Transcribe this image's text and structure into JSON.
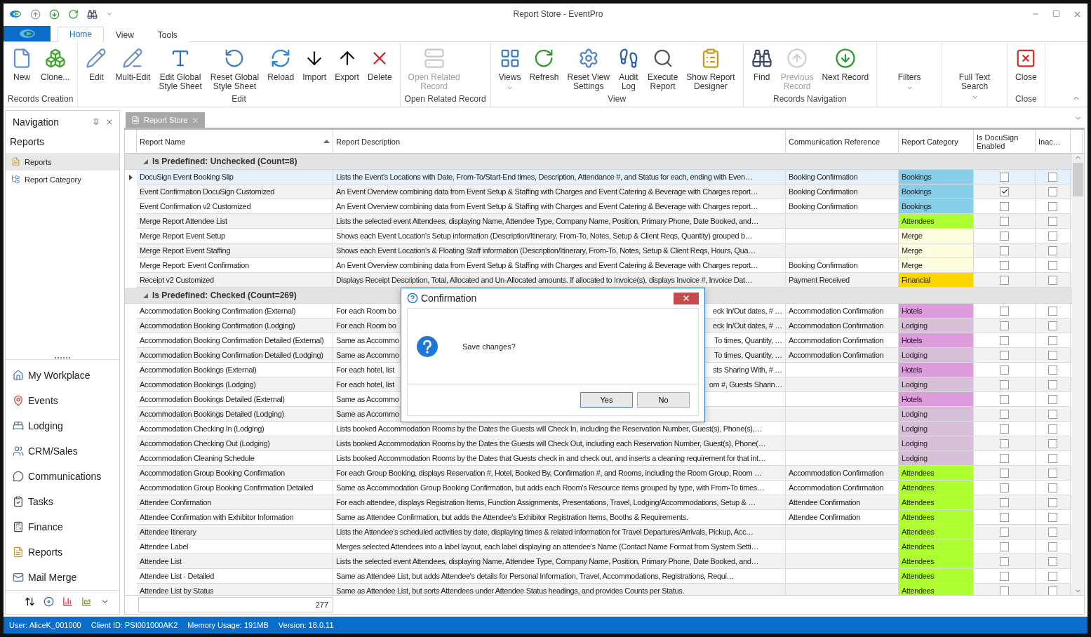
{
  "window": {
    "title": "Report Store - EventPro"
  },
  "tabs": [
    {
      "label": "Home",
      "selected": true
    },
    {
      "label": "View",
      "selected": false
    },
    {
      "label": "Tools",
      "selected": false
    }
  ],
  "ribbon": {
    "groups": [
      {
        "label": "Records Creation",
        "buttons": [
          {
            "label": "New",
            "kind": "new",
            "disabled": false,
            "dropdown": false
          },
          {
            "label": "Clone...",
            "kind": "clone",
            "disabled": false,
            "dropdown": false
          }
        ]
      },
      {
        "label": "Edit",
        "buttons": [
          {
            "label": "Edit",
            "kind": "edit",
            "disabled": false,
            "dropdown": false
          },
          {
            "label": "Multi-Edit",
            "kind": "multiedit",
            "disabled": false,
            "dropdown": false
          },
          {
            "label": "Edit Global\nStyle Sheet",
            "kind": "style",
            "disabled": false,
            "dropdown": false
          },
          {
            "label": "Reset Global\nStyle Sheet",
            "kind": "reset",
            "disabled": false,
            "dropdown": false
          },
          {
            "label": "Reload",
            "kind": "reload",
            "disabled": false,
            "dropdown": false
          },
          {
            "label": "Import",
            "kind": "import",
            "disabled": false,
            "dropdown": false
          },
          {
            "label": "Export",
            "kind": "export",
            "disabled": false,
            "dropdown": false
          },
          {
            "label": "Delete",
            "kind": "delete",
            "disabled": false,
            "dropdown": false
          }
        ]
      },
      {
        "label": "Open Related Record",
        "buttons": [
          {
            "label": "Open Related\nRecord",
            "kind": "related",
            "disabled": true,
            "dropdown": false
          }
        ]
      },
      {
        "label": "View",
        "buttons": [
          {
            "label": "Views",
            "kind": "views",
            "disabled": false,
            "dropdown": true
          },
          {
            "label": "Refresh",
            "kind": "refresh",
            "disabled": false,
            "dropdown": false
          },
          {
            "label": "Reset View\nSettings",
            "kind": "resetview",
            "disabled": false,
            "dropdown": false
          },
          {
            "label": "Audit\nLog",
            "kind": "audit",
            "disabled": false,
            "dropdown": false
          },
          {
            "label": "Execute\nReport",
            "kind": "execute",
            "disabled": false,
            "dropdown": false
          },
          {
            "label": "Show Report\nDesigner",
            "kind": "designer",
            "disabled": false,
            "dropdown": false
          }
        ]
      },
      {
        "label": "Records Navigation",
        "buttons": [
          {
            "label": "Find",
            "kind": "find",
            "disabled": false,
            "dropdown": false
          },
          {
            "label": "Previous\nRecord",
            "kind": "previous",
            "disabled": true,
            "dropdown": false
          },
          {
            "label": "Next Record",
            "kind": "next",
            "disabled": false,
            "dropdown": false
          }
        ]
      },
      {
        "buttons": [
          {
            "label": "Filters",
            "kind": "none",
            "disabled": false,
            "dropdown": true
          }
        ]
      },
      {
        "buttons": [
          {
            "label": "Full Text\nSearch",
            "kind": "none",
            "disabled": false,
            "dropdown": true
          }
        ]
      },
      {
        "label": "Close",
        "buttons": [
          {
            "label": "Close",
            "kind": "close",
            "disabled": false,
            "dropdown": false
          }
        ]
      }
    ]
  },
  "navigation": {
    "title": "Navigation",
    "section": "Reports",
    "items": [
      {
        "label": "Reports",
        "kind": "reports",
        "selected": true
      },
      {
        "label": "Report Category",
        "kind": "category",
        "selected": false
      }
    ],
    "modules": [
      {
        "label": "My Workplace",
        "kind": "home"
      },
      {
        "label": "Events",
        "kind": "events"
      },
      {
        "label": "Lodging",
        "kind": "lodging"
      },
      {
        "label": "CRM/Sales",
        "kind": "crm"
      },
      {
        "label": "Communications",
        "kind": "comms"
      },
      {
        "label": "Tasks",
        "kind": "tasks"
      },
      {
        "label": "Finance",
        "kind": "finance"
      },
      {
        "label": "Reports",
        "kind": "reports"
      },
      {
        "label": "Mail Merge",
        "kind": "merge"
      }
    ]
  },
  "document_tab": {
    "label": "Report Store"
  },
  "table": {
    "columns": [
      "Report Name",
      "Report Description",
      "Communication Reference",
      "Report Category",
      "Is DocuSign\nEnabled",
      "Inac…"
    ],
    "groups": [
      {
        "label": "Is Predefined: Unchecked (Count=8)",
        "expanded": true,
        "rows": [
          {
            "name": "DocuSign Event Booking Slip",
            "description": "Lists the Event's Locations with Date, From-To/Start-End times, Description, Attendance #, and Status for each, ending with Even…",
            "communication_reference": "Booking Confirmation",
            "category": "Bookings",
            "color": "#87ceeb",
            "docusign": false,
            "inactive": false,
            "selected": true
          },
          {
            "name": "Event Confirmation DocuSign Customized",
            "description": "An Event Overview combining data from Event Setup & Staffing with Charges and Event Catering & Beverage with Charges report…",
            "communication_reference": "Booking Confirmation",
            "category": "Bookings",
            "color": "#87ceeb",
            "docusign": true,
            "inactive": false,
            "selected": false
          },
          {
            "name": "Event Confirmation v2 Customized",
            "description": "An Event Overview combining data from Event Setup & Staffing with Charges and Event Catering & Beverage with Charges report…",
            "communication_reference": "Booking Confirmation",
            "category": "Bookings",
            "color": "#87ceeb",
            "docusign": false,
            "inactive": false,
            "selected": false
          },
          {
            "name": "Merge Report Attendee List",
            "description": "Lists the selected event Attendees, displaying Name, Attendee Type, Company Name, Position, Primary Phone, Date Booked, and…",
            "category": "Attendees",
            "color": "#adff2f",
            "docusign": false,
            "inactive": false,
            "selected": false
          },
          {
            "name": "Merge Report Event Setup",
            "description": "Shows each Event Location's Setup information (Description/Itinerary, From-To, Notes, Setup & Client Reqs, Quantity) grouped b…",
            "category": "Merge",
            "color": "#fffde0",
            "docusign": false,
            "inactive": false,
            "selected": false
          },
          {
            "name": "Merge Report Event Staffing",
            "description": "Shows each Event Location's & Floating Staff information (Description/Itinerary, From-To, Notes, Setup & Client Reqs, Hours, Qua…",
            "category": "Merge",
            "color": "#fffde0",
            "docusign": false,
            "inactive": false,
            "selected": false
          },
          {
            "name": "Merge Report: Event Confirmation",
            "description": "An Event Overview combining data from Event Setup & Staffing with Charges and Event Catering & Beverage with Charges report…",
            "communication_reference": "Booking Confirmation",
            "category": "Merge",
            "color": "#fffde0",
            "docusign": false,
            "inactive": false,
            "selected": false
          },
          {
            "name": "Receipt v2 Customized",
            "description": "Displays Receipt Description, Total, Allocated and Un-Allocated amounts. If allocated to Invoice(s), displays Invoice #, Invoice Dat…",
            "communication_reference": "Payment Received",
            "category": "Financial",
            "color": "#ffd700",
            "docusign": false,
            "inactive": false,
            "selected": false
          }
        ]
      },
      {
        "label": "Is Predefined: Checked (Count=269)",
        "expanded": true,
        "rows": [
          {
            "name": "Accommodation Booking Confirmation (External)",
            "description_parts": [
              "For each Room bo",
              "eck In/Out dates, # …"
            ],
            "communication_reference": "Accommodation Confirmation",
            "category": "Hotels",
            "color": "#dd9ddd",
            "docusign": false,
            "inactive": false,
            "selected": false
          },
          {
            "name": "Accommodation Booking Confirmation (Lodging)",
            "description_parts": [
              "For each Room bo",
              "eck In/Out dates, # …"
            ],
            "communication_reference": "Accommodation Confirmation",
            "category": "Lodging",
            "color": "#d8bfd8",
            "docusign": false,
            "inactive": false,
            "selected": false
          },
          {
            "name": "Accommodation Booking Confirmation Detailed (External)",
            "description_parts": [
              "Same as Accommo",
              "To times, Quantity, …"
            ],
            "communication_reference": "Accommodation Confirmation",
            "category": "Hotels",
            "color": "#dd9ddd",
            "docusign": false,
            "inactive": false,
            "selected": false
          },
          {
            "name": "Accommodation Booking Confirmation Detailed (Lodging)",
            "description_parts": [
              "Same as Accommo",
              "To times, Quantity, …"
            ],
            "communication_reference": "Accommodation Confirmation",
            "category": "Lodging",
            "color": "#d8bfd8",
            "docusign": false,
            "inactive": false,
            "selected": false
          },
          {
            "name": "Accommodation Bookings (External)",
            "description_parts": [
              "For each hotel, list",
              "sts Sharing With, # …"
            ],
            "category": "Hotels",
            "color": "#dd9ddd",
            "docusign": false,
            "inactive": false,
            "selected": false
          },
          {
            "name": "Accommodation Bookings (Lodging)",
            "description_parts": [
              "For each hotel, list",
              "om #, Guests Sharin…"
            ],
            "category": "Lodging",
            "color": "#d8bfd8",
            "docusign": false,
            "inactive": false,
            "selected": false
          },
          {
            "name": "Accommodation Bookings Detailed (External)",
            "description_parts": [
              "Same as Accommo"
            ],
            "category": "Hotels",
            "color": "#dd9ddd",
            "docusign": false,
            "inactive": false,
            "selected": false
          },
          {
            "name": "Accommodation Bookings Detailed (Lodging)",
            "description_parts": [
              "Same as Accommo"
            ],
            "category": "Lodging",
            "color": "#d8bfd8",
            "docusign": false,
            "inactive": false,
            "selected": false
          },
          {
            "name": "Accommodation Checking In (Lodging)",
            "description": "Lists booked Accommodation Rooms by the Dates the Guests will Check In, including the Reservation Number, Guest(s), Phone(s),…",
            "category": "Lodging",
            "color": "#d8bfd8",
            "docusign": false,
            "inactive": false,
            "selected": false
          },
          {
            "name": "Accommodation Checking Out (Lodging)",
            "description": "Lists booked Accommodation Rooms by the Dates the Guests will Check Out, including each Reservation Number, Guest(s), Phone(…",
            "category": "Lodging",
            "color": "#d8bfd8",
            "docusign": false,
            "inactive": false,
            "selected": false
          },
          {
            "name": "Accommodation Cleaning Schedule",
            "description": "Lists booked Accommodation Rooms by the Dates that Guests check in and check out, and inserts a cleaning requirement for that int…",
            "category": "Lodging",
            "color": "#d8bfd8",
            "docusign": false,
            "inactive": false,
            "selected": false
          },
          {
            "name": "Accommodation Group Booking Confirmation",
            "description": "For each Group Booking, displays Reservation #, Hotel, Booked By, Confirmation #, and Rooms, including the Room Group, Room …",
            "communication_reference": "Accommodation Confirmation",
            "category": "Attendees",
            "color": "#adff2f",
            "docusign": false,
            "inactive": false,
            "selected": false
          },
          {
            "name": "Accommodation Group Booking Confirmation Detailed",
            "description": "Same as Accommodation Group Booking Confirmation, but adds each Room's Resource items grouped by type, with From-To times…",
            "communication_reference": "Accommodation Confirmation",
            "category": "Attendees",
            "color": "#adff2f",
            "docusign": false,
            "inactive": false,
            "selected": false
          },
          {
            "name": "Attendee Confirmation",
            "description": "For each attendee, displays Registration Items, Function Assignments, Presentations, Travel, Lodging/Accommodations, Setup & …",
            "communication_reference": "Attendee Confirmation",
            "category": "Attendees",
            "color": "#adff2f",
            "docusign": false,
            "inactive": false,
            "selected": false
          },
          {
            "name": "Attendee Confirmation with Exhibitor Information",
            "description": "Same as Attendee Confirmation, but adds the Attendee's Exhibitor Registration Items, Booths & Requirements.",
            "communication_reference": "Attendee Confirmation",
            "category": "Attendees",
            "color": "#adff2f",
            "docusign": false,
            "inactive": false,
            "selected": false
          },
          {
            "name": "Attendee Itinerary",
            "description": "Lists the Attendee's scheduled activities by date, displaying times & related information for Travel Departures/Arrivals, Pickup, Acc…",
            "category": "Attendees",
            "color": "#adff2f",
            "docusign": false,
            "inactive": false,
            "selected": false
          },
          {
            "name": "Attendee Label",
            "description": "Merges selected Attendees into a label layout, each label displaying an attendee's Name (Contact Name Format from System Setti…",
            "category": "Attendees",
            "color": "#adff2f",
            "docusign": false,
            "inactive": false,
            "selected": false
          },
          {
            "name": "Attendee List",
            "description": "Lists the selected event Attendees, displaying Name, Attendee Type, Company Name, Position, Primary Phone, Date Booked, and…",
            "category": "Attendees",
            "color": "#adff2f",
            "docusign": false,
            "inactive": false,
            "selected": false
          },
          {
            "name": "Attendee List - Detailed",
            "description": "Same as Attendee List, but adds Attendee's details for Personal Information, Travel, Accommodations, Registrations, Requi…",
            "category": "Attendees",
            "color": "#adff2f",
            "docusign": false,
            "inactive": false,
            "selected": false
          },
          {
            "name": "Attendee List by Status",
            "description": "Same as Attendee List, but sorts Attendees under Attendee Status headings, and provides Counts per Status.",
            "category": "Attendees",
            "color": "#adff2f",
            "docusign": false,
            "inactive": false,
            "selected": false
          }
        ]
      }
    ],
    "footer_count": "277"
  },
  "dialog": {
    "title": "Confirmation",
    "message": "Save changes?",
    "buttons": [
      {
        "label": "Yes",
        "selected": true
      },
      {
        "label": "No",
        "selected": false
      }
    ]
  },
  "status_bar": [
    "User: AliceK_001000",
    "Client ID: PSI001000AK2",
    "Memory Usage: 191MB",
    "Version: 18.0.11"
  ]
}
